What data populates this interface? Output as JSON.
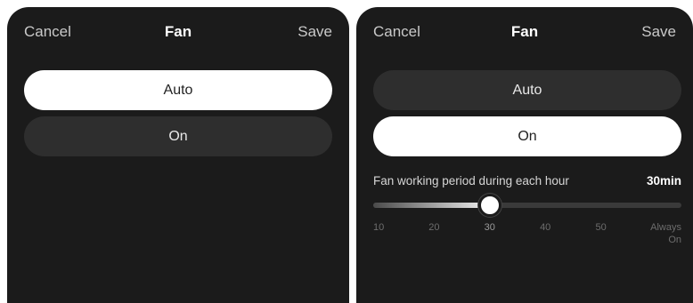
{
  "left_screen": {
    "header": {
      "cancel_label": "Cancel",
      "title": "Fan",
      "save_label": "Save"
    },
    "options": [
      {
        "label": "Auto",
        "selected": true
      },
      {
        "label": "On",
        "selected": false
      }
    ]
  },
  "right_screen": {
    "header": {
      "cancel_label": "Cancel",
      "title": "Fan",
      "save_label": "Save"
    },
    "options": [
      {
        "label": "Auto",
        "selected": false
      },
      {
        "label": "On",
        "selected": true
      }
    ],
    "period": {
      "label": "Fan working period during each hour",
      "value_label": "30min",
      "slider_value": 30,
      "slider_min": 10,
      "slider_max": 60,
      "ticks": [
        "10",
        "20",
        "30",
        "40",
        "50",
        "Always\nOn"
      ]
    }
  },
  "colors": {
    "panel_bg": "#1b1b1b",
    "selected_option_bg": "#ffffff",
    "unselected_option_bg": "#2e2e2e"
  }
}
